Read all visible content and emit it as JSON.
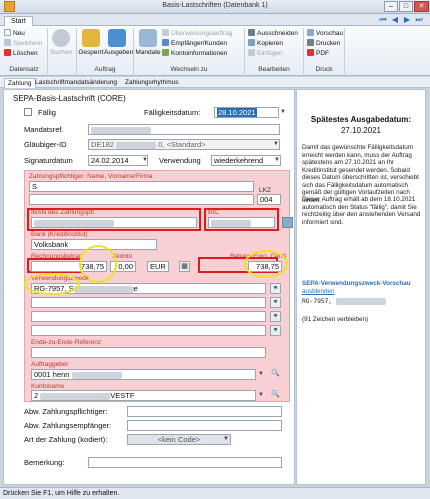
{
  "window": {
    "title": "Basis-Lastschriften (Datenbank 1)"
  },
  "ribbon": {
    "tab_start": "Start",
    "datensatz": {
      "label": "Datensatz",
      "neu": "Neu",
      "speichern": "Speichern",
      "loeschen": "Löschen"
    },
    "suchen": "Suchen",
    "auftrag": {
      "label": "Auftrag",
      "gesperrt": "Gesperrt",
      "ausgeben": "Ausgeben"
    },
    "wechseln": {
      "label": "Wechseln zu",
      "mandate": "Mandate",
      "ueberweisung": "Überweisungsauftrag",
      "empfaenger": "Empfänger/Kunden",
      "kontoinfo": "Kontoinformationen"
    },
    "bearbeiten": {
      "label": "Bearbeiten",
      "ausschneiden": "Ausschneiden",
      "kopieren": "Kopieren",
      "einfuegen": "Einfügen"
    },
    "druck": {
      "label": "Druck",
      "vorschau": "Vorschau",
      "drucken": "Drucken",
      "pdf": "PDF"
    }
  },
  "subtabs": [
    "Zahlung",
    "Lastschriftmandatsänderung",
    "Zahlungsrhythmus"
  ],
  "form": {
    "heading": "SEPA-Basis-Lastschrift (CORE)",
    "faellig_label": "Fällig",
    "faelligkeitsdatum_label": "Fälligkeitsdatum:",
    "faelligkeitsdatum": "28.10.2021",
    "mandatsref_label": "Mandatsref.",
    "glaeubiger_label": "Gläubiger-ID",
    "glaeubiger_value": "DE182",
    "glaeubiger_standard": "0, <Standard>",
    "signaturdatum_label": "Signaturdatum",
    "signaturdatum": "24.02.2014",
    "verwendung_label": "Verwendung",
    "verwendung": "wiederkehrend",
    "zahlungspflichtiger_label": "Zahlungspflichtiger: Name, Vorname/Firma",
    "zahlungspflichtiger_value": "S",
    "lkz_label": "LKZ",
    "lkz": "004",
    "iban_label": "IBAN des Zahlungspfl.",
    "bic_label": "BIC",
    "bank_label": "Bank (Kreditinstitut)",
    "bank": "Volksbank",
    "rechnungsbetrag_label": "Rechnungsbetrag",
    "rechnungsbetrag": "738,75",
    "skonto_label": "Skonto",
    "skonto": "0,00",
    "waehrung": "EUR",
    "betrag_label": "Betrag (Euro, Cent)",
    "betrag": "738,75",
    "verwendungszweck_label": "Verwendungszweck",
    "verwendungszweck1": "RG-7957, S",
    "verwendungszweck1_tail": "e",
    "e2e_label": "Ende-zu-Ende-Referenz",
    "auftraggeber_label": "Auftraggeber",
    "auftraggeber": "0001 henn",
    "kontoname_label": "Kontoname",
    "kontoname": "2",
    "kontoname_tail": "VESTF",
    "abw_pfl_label": "Abw. Zahlungspflichtiger:",
    "abw_empf_label": "Abw. Zahlungsempfänger:",
    "art_label": "Art der Zahlung (kodiert):",
    "art_value": "<kein Code>",
    "bemerkung_label": "Bemerkung:"
  },
  "side": {
    "title": "Spätestes Ausgabedatum:",
    "date": "27.10.2021",
    "para1": "Damit das gewünschte Fälligkeitsdatum erreicht werden kann, muss der Auftrag spätestens am 27.10.2021 an Ihr Kreditinstitut gesendet werden. Sobald dieses Datum überschritten ist, verschiebt sich das Fälligkeitsdatum automatisch gemäß der gültigen Vorlaufzeiten nach hinten.",
    "para2": "Dieser Auftrag erhält ab dem 18.10.2021 automatisch den Status \"fällig\", damit Sie rechtzeitig über den anstehenden Versand informiert sind.",
    "vorschau_title": "SEPA-Verwendungszweck-Vorschau",
    "ausblenden": "ausblenden",
    "vorschau_line": "RG-7957,",
    "remaining": "(91 Zeichen verbleiben)"
  },
  "status": "Drücken Sie F1, um Hilfe zu erhalten.",
  "colors": {
    "accent": "#2a6fb5",
    "required_bg": "#f8cfd2",
    "highlight_red": "#e01b1b",
    "highlight_yellow": "#f0e21c"
  }
}
